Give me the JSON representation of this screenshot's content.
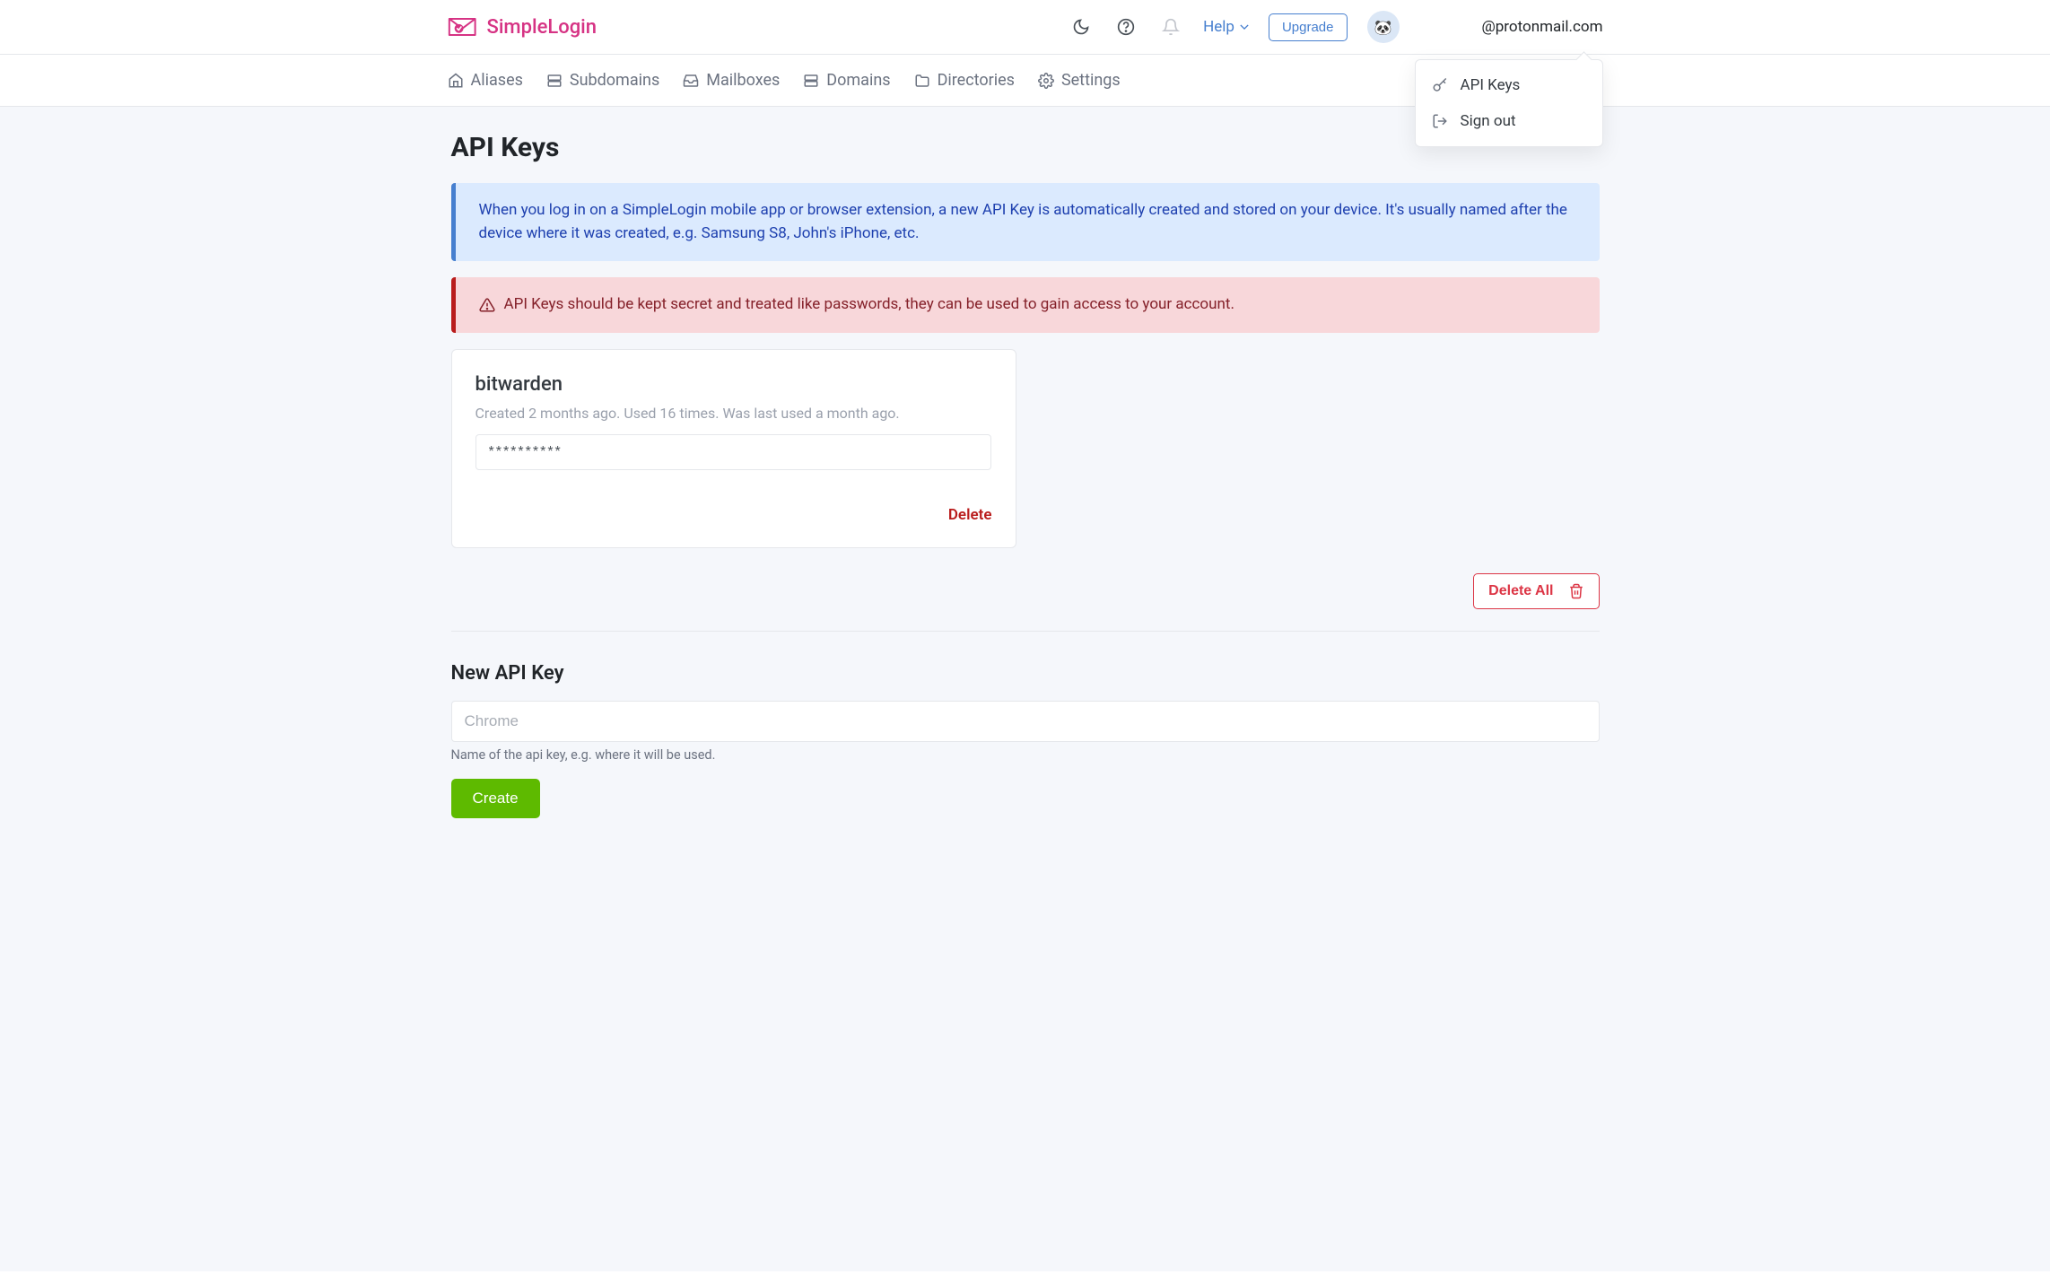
{
  "brand": {
    "name": "SimpleLogin"
  },
  "header": {
    "help_label": "Help",
    "upgrade_label": "Upgrade",
    "user_email": "@protonmail.com"
  },
  "dropdown": {
    "api_keys_label": "API Keys",
    "sign_out_label": "Sign out"
  },
  "tabs": [
    {
      "id": "aliases",
      "label": "Aliases"
    },
    {
      "id": "subdomains",
      "label": "Subdomains"
    },
    {
      "id": "mailboxes",
      "label": "Mailboxes"
    },
    {
      "id": "domains",
      "label": "Domains"
    },
    {
      "id": "directories",
      "label": "Directories"
    },
    {
      "id": "settings",
      "label": "Settings"
    }
  ],
  "page": {
    "title": "API Keys",
    "info_text": "When you log in on a SimpleLogin mobile app or browser extension, a new API Key is automatically created and stored on your device. It's usually named after the device where it was created, e.g. Samsung S8, John's iPhone, etc.",
    "warning_text": "API Keys should be kept secret and treated like passwords, they can be used to gain access to your account."
  },
  "api_keys": [
    {
      "name": "bitwarden",
      "meta": "Created 2 months ago. Used 16 times. Was last used a month ago.",
      "masked_value": "**********",
      "delete_label": "Delete"
    }
  ],
  "delete_all_label": "Delete All",
  "new_key": {
    "heading": "New API Key",
    "placeholder": "Chrome",
    "hint": "Name of the api key, e.g. where it will be used.",
    "create_label": "Create"
  }
}
